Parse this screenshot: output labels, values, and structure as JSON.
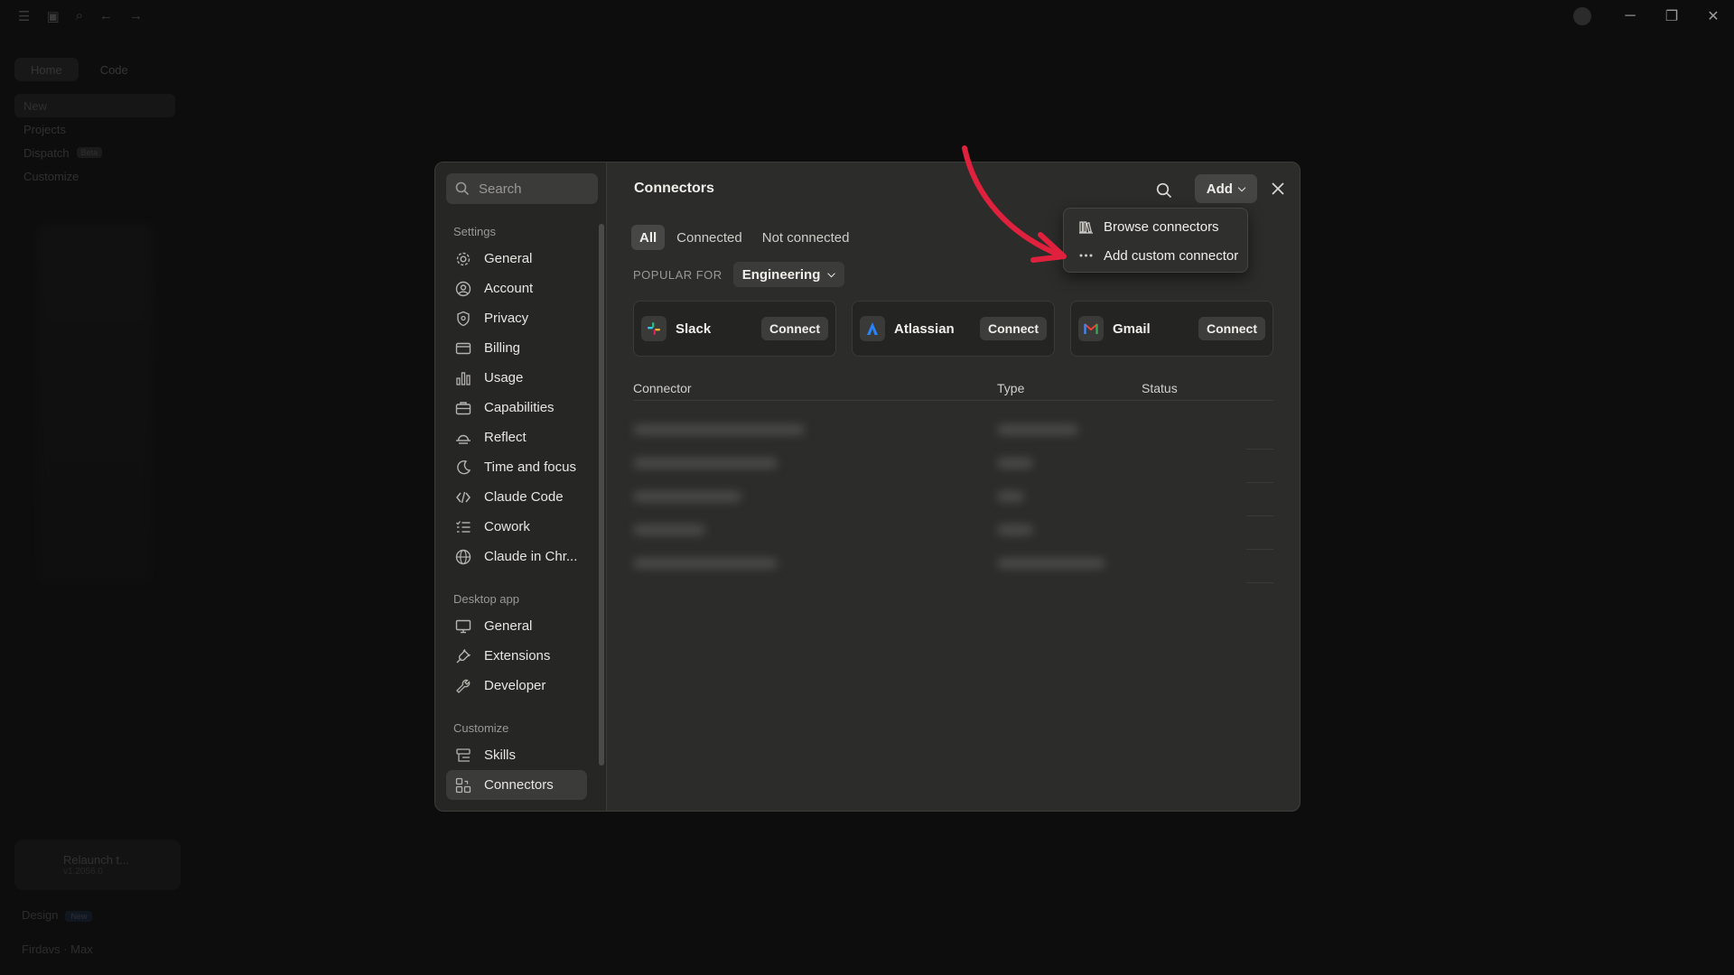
{
  "app": {
    "mode_tabs": [
      "Home",
      "Code"
    ],
    "sidebar_items": [
      {
        "label": "New"
      },
      {
        "label": "Projects"
      },
      {
        "label": "Dispatch",
        "badge": "Beta"
      },
      {
        "label": "Customize"
      }
    ],
    "project_card": {
      "title": "Relaunch t...",
      "version": "v1.2056.0"
    },
    "bottom_items": [
      {
        "label": "Design",
        "badge": "New"
      },
      {
        "label": "Firdavs · Max"
      }
    ]
  },
  "settings_nav": {
    "search_placeholder": "Search",
    "sections": [
      {
        "title": "Settings",
        "items": [
          {
            "label": "General",
            "icon": "gear-icon"
          },
          {
            "label": "Account",
            "icon": "user-circle-icon"
          },
          {
            "label": "Privacy",
            "icon": "shield-icon"
          },
          {
            "label": "Billing",
            "icon": "credit-card-icon"
          },
          {
            "label": "Usage",
            "icon": "bar-chart-icon"
          },
          {
            "label": "Capabilities",
            "icon": "briefcase-icon"
          },
          {
            "label": "Reflect",
            "icon": "sunrise-icon"
          },
          {
            "label": "Time and focus",
            "icon": "moon-clock-icon"
          },
          {
            "label": "Claude Code",
            "icon": "code-icon"
          },
          {
            "label": "Cowork",
            "icon": "list-check-icon"
          },
          {
            "label": "Claude in Chr...",
            "icon": "globe-icon"
          }
        ]
      },
      {
        "title": "Desktop app",
        "items": [
          {
            "label": "General",
            "icon": "monitor-icon"
          },
          {
            "label": "Extensions",
            "icon": "plug-icon"
          },
          {
            "label": "Developer",
            "icon": "wrench-icon"
          }
        ]
      },
      {
        "title": "Customize",
        "items": [
          {
            "label": "Skills",
            "icon": "skills-icon"
          },
          {
            "label": "Connectors",
            "icon": "connectors-icon",
            "active": true
          }
        ]
      }
    ]
  },
  "connectors": {
    "title": "Connectors",
    "add_label": "Add",
    "tabs": [
      {
        "label": "All",
        "active": true
      },
      {
        "label": "Connected"
      },
      {
        "label": "Not connected"
      }
    ],
    "popular_for_label": "POPULAR FOR",
    "popular_for_value": "Engineering",
    "featured": [
      {
        "name": "Slack",
        "action": "Connect",
        "logo": "slack-logo"
      },
      {
        "name": "Atlassian",
        "action": "Connect",
        "logo": "atlassian-logo"
      },
      {
        "name": "Gmail",
        "action": "Connect",
        "logo": "gmail-logo"
      }
    ],
    "table_headers": {
      "connector": "Connector",
      "type": "Type",
      "status": "Status"
    }
  },
  "add_menu": {
    "items": [
      {
        "label": "Browse connectors",
        "icon": "library-icon"
      },
      {
        "label": "Add custom connector",
        "icon": "ellipsis-icon"
      }
    ]
  },
  "colors": {
    "accent_arrow": "#e0213d",
    "dialog_bg": "#2c2c2b",
    "nav_bg": "#262625"
  }
}
